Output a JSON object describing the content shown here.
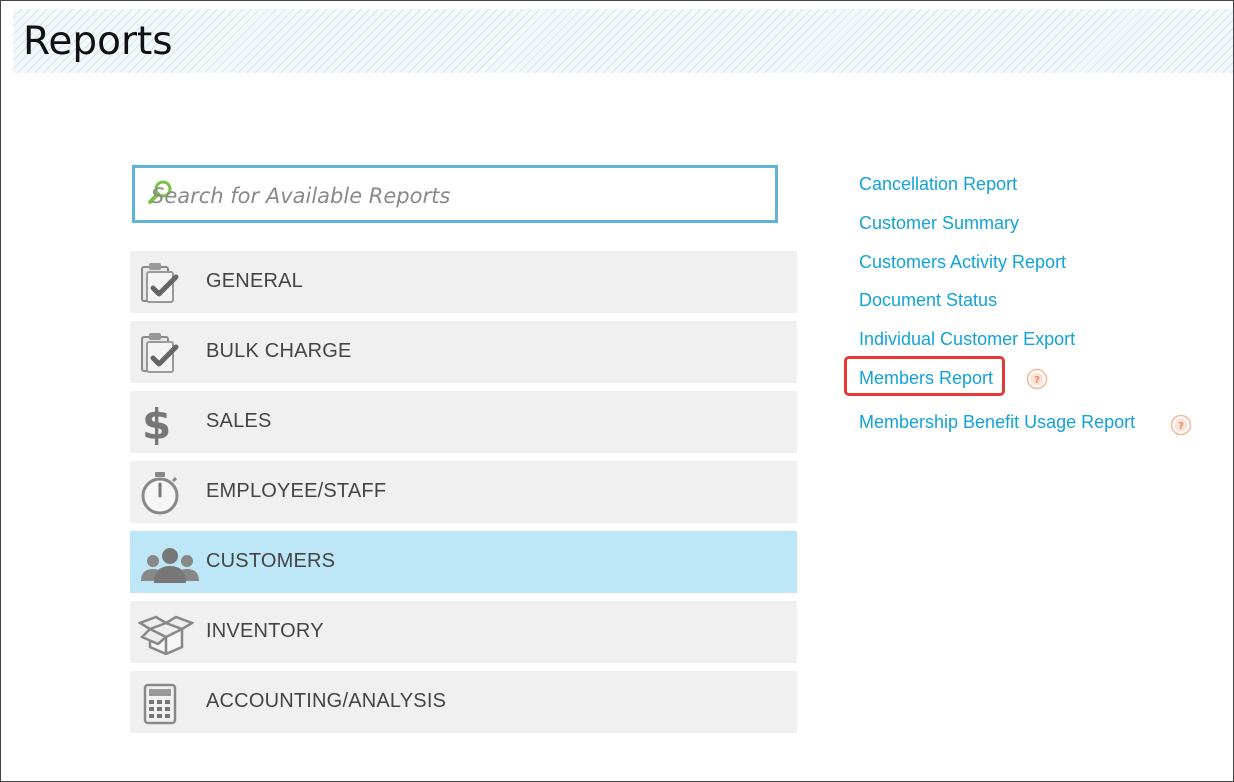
{
  "page": {
    "title": "Reports"
  },
  "search": {
    "placeholder": "Search for Available Reports"
  },
  "categories": [
    {
      "label": "GENERAL",
      "icon": "clipboard-check-icon"
    },
    {
      "label": "BULK CHARGE",
      "icon": "clipboard-check-icon"
    },
    {
      "label": "SALES",
      "icon": "dollar-icon"
    },
    {
      "label": "EMPLOYEE/STAFF",
      "icon": "stopwatch-icon"
    },
    {
      "label": "CUSTOMERS",
      "icon": "people-icon",
      "active": true
    },
    {
      "label": "INVENTORY",
      "icon": "open-box-icon"
    },
    {
      "label": "ACCOUNTING/ANALYSIS",
      "icon": "calculator-icon"
    }
  ],
  "reports": [
    {
      "label": "Cancellation Report"
    },
    {
      "label": "Customer Summary"
    },
    {
      "label": "Customers Activity Report"
    },
    {
      "label": "Document Status"
    },
    {
      "label": "Individual Customer Export"
    },
    {
      "label": "Members Report",
      "highlighted": true,
      "help": true
    },
    {
      "label": "Membership Benefit Usage Report",
      "help": true
    }
  ],
  "colors": {
    "link": "#12a3d8",
    "active_category": "#bde7f7",
    "search_border": "#5fb3d9",
    "highlight": "#e53935",
    "help_icon": "#f4b89a"
  }
}
